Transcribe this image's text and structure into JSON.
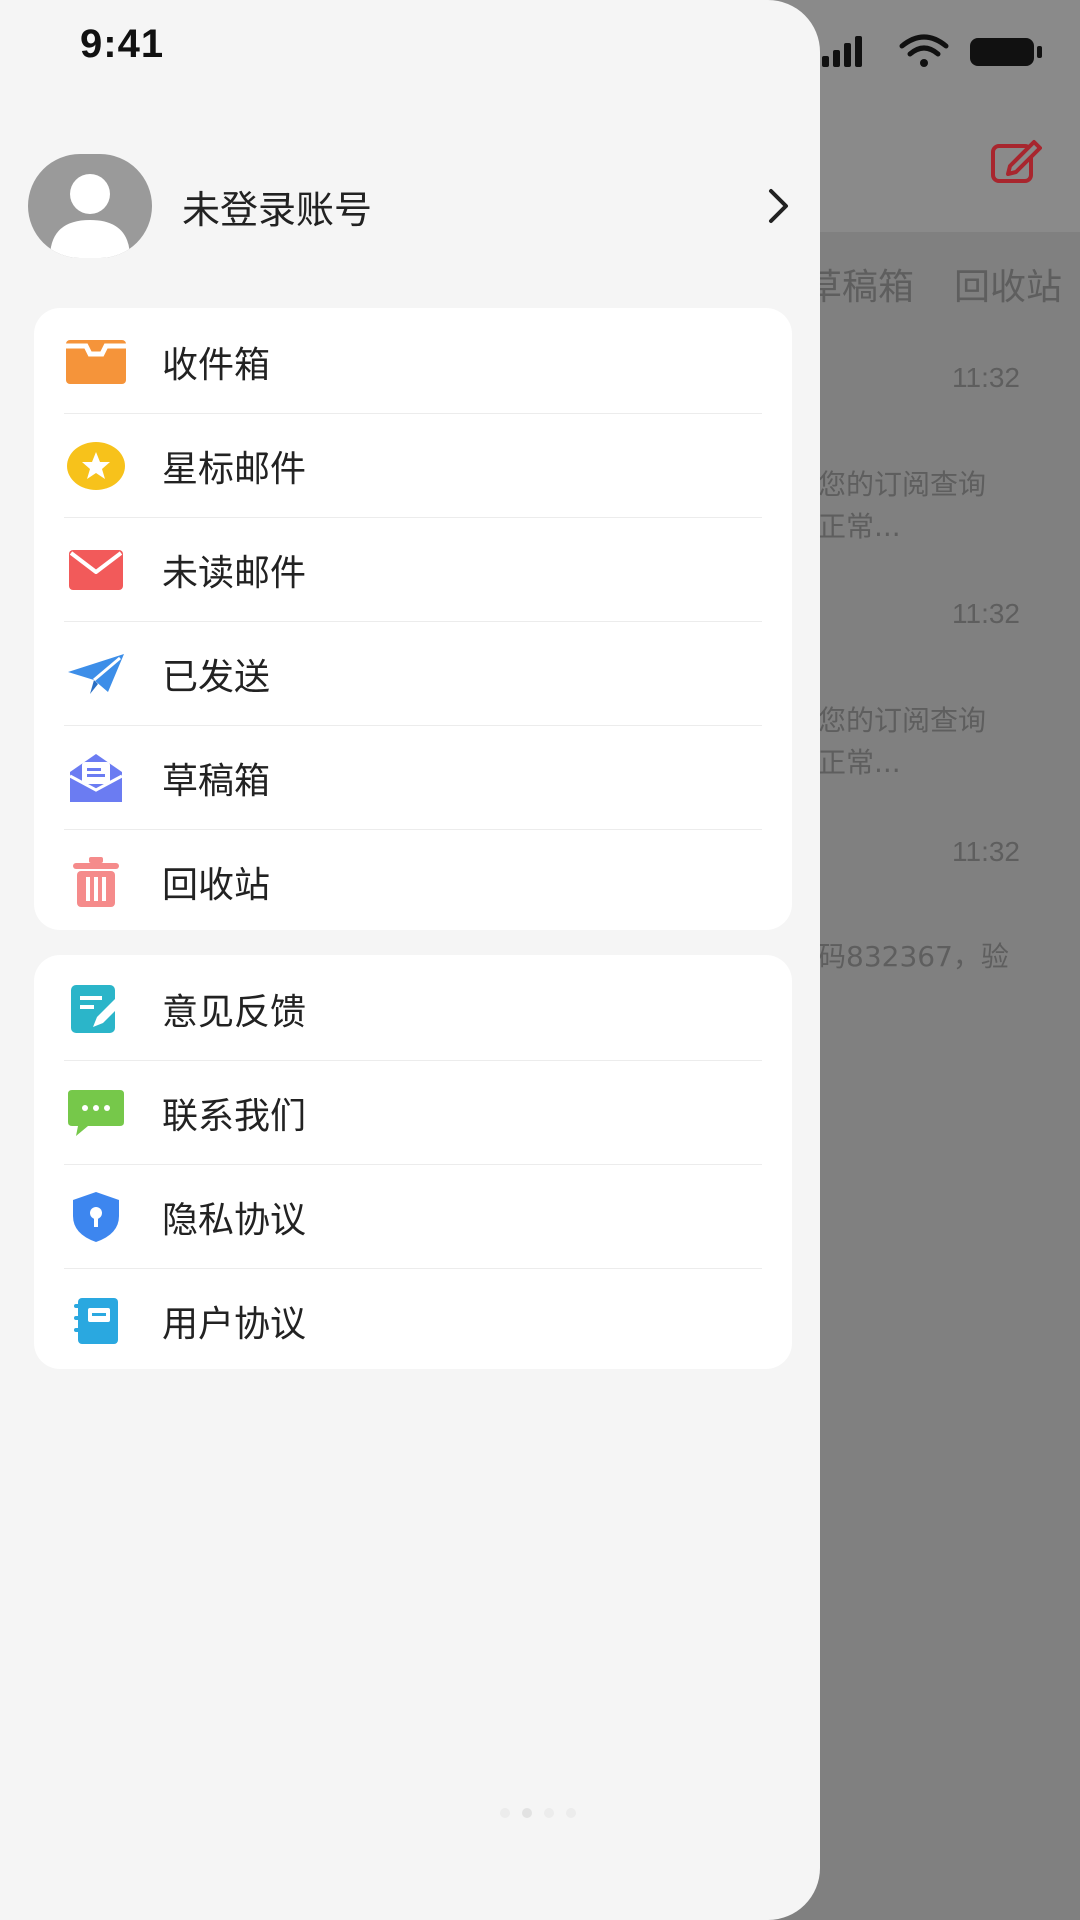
{
  "status_bar": {
    "time": "9:41"
  },
  "profile": {
    "name": "未登录账号"
  },
  "menu_primary": [
    {
      "label": "收件箱",
      "icon": "inbox-icon",
      "color": "#f5943a"
    },
    {
      "label": "星标邮件",
      "icon": "star-icon",
      "color": "#f7c21b"
    },
    {
      "label": "未读邮件",
      "icon": "unread-mail-icon",
      "color": "#f25a5a"
    },
    {
      "label": "已发送",
      "icon": "paper-plane-icon",
      "color": "#3d8ee8"
    },
    {
      "label": "草稿箱",
      "icon": "drafts-icon",
      "color": "#6b7cf2"
    },
    {
      "label": "回收站",
      "icon": "trash-icon",
      "color": "#f58b8b"
    }
  ],
  "menu_secondary": [
    {
      "label": "意见反馈",
      "icon": "feedback-icon",
      "color": "#2bb5c9"
    },
    {
      "label": "联系我们",
      "icon": "chat-bubble-icon",
      "color": "#76c84a"
    },
    {
      "label": "隐私协议",
      "icon": "shield-icon",
      "color": "#3d86ef"
    },
    {
      "label": "用户协议",
      "icon": "agreement-book-icon",
      "color": "#2aa8e0"
    }
  ],
  "background": {
    "tabs": [
      "草稿箱",
      "回收站"
    ],
    "mails": [
      {
        "time": "11:32",
        "snippet_line1": "您的订阅查询",
        "snippet_line2": "正常..."
      },
      {
        "time": "11:32",
        "snippet_line1": "您的订阅查询",
        "snippet_line2": "正常..."
      },
      {
        "time": "11:32",
        "snippet_line1": "码832367，验",
        "snippet_line2": ""
      }
    ],
    "compose_color": "#a8262e"
  }
}
